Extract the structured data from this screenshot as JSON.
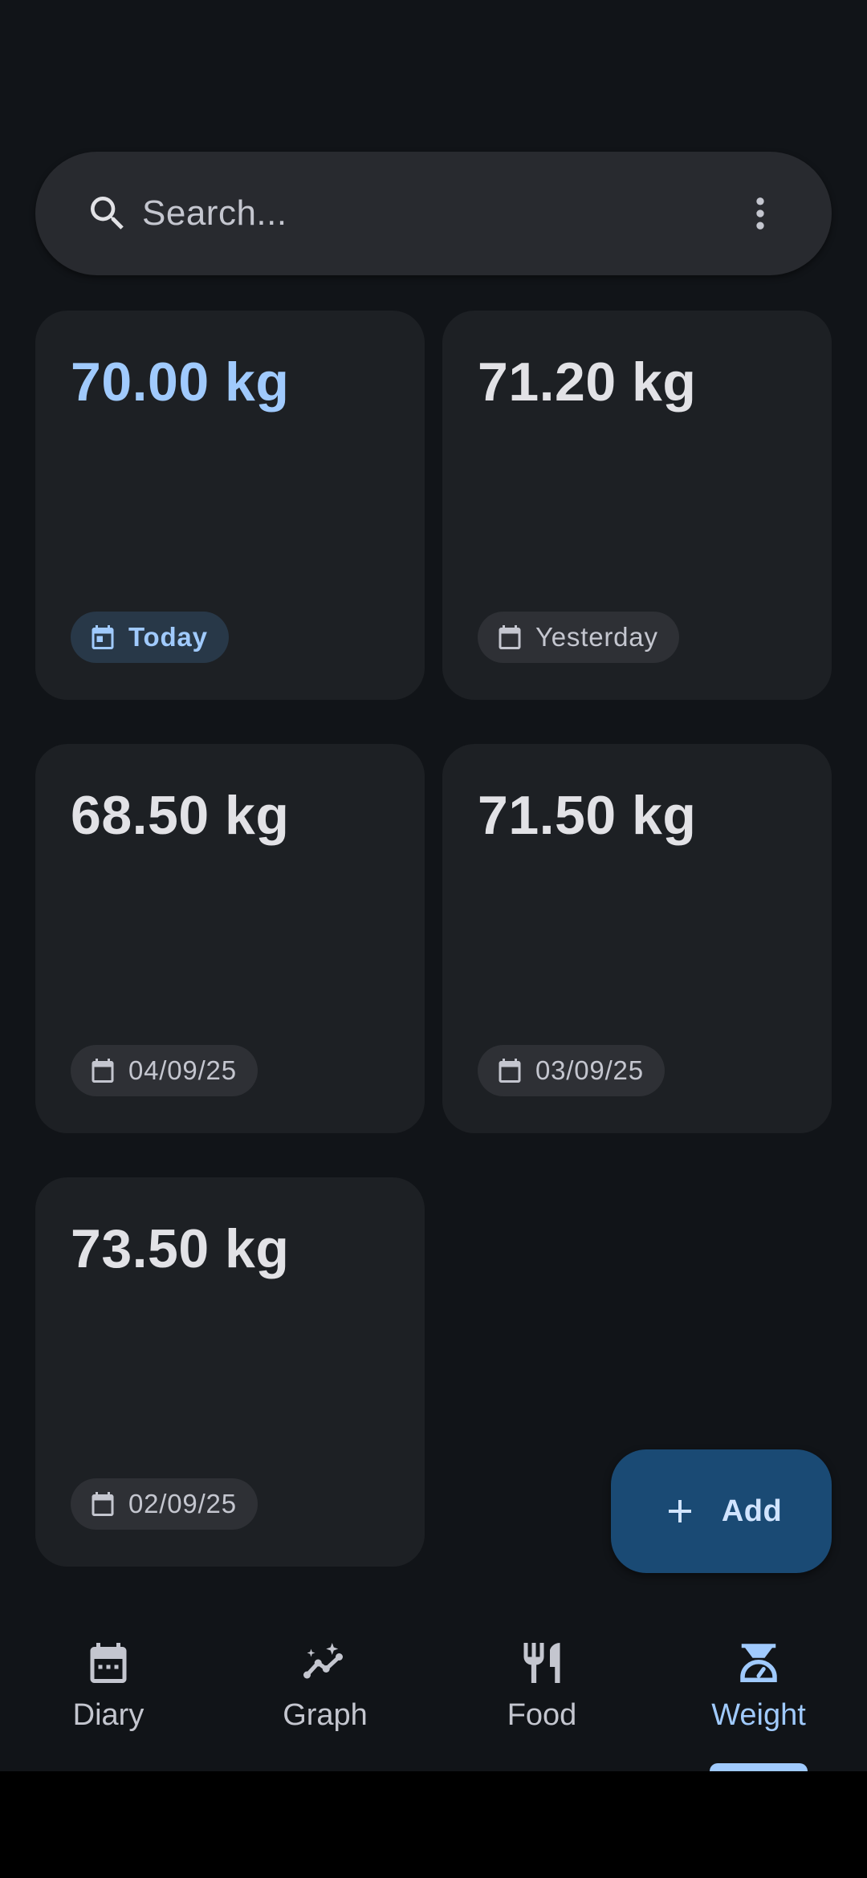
{
  "search": {
    "placeholder": "Search..."
  },
  "entries": [
    {
      "weight": "70.00 kg",
      "date": "Today",
      "highlight": true
    },
    {
      "weight": "71.20 kg",
      "date": "Yesterday",
      "highlight": false
    },
    {
      "weight": "68.50 kg",
      "date": "04/09/25",
      "highlight": false
    },
    {
      "weight": "71.50 kg",
      "date": "03/09/25",
      "highlight": false
    },
    {
      "weight": "73.50 kg",
      "date": "02/09/25",
      "highlight": false
    }
  ],
  "fab": {
    "label": "Add",
    "icon": "plus-icon"
  },
  "nav": {
    "items": [
      {
        "label": "Diary",
        "icon": "calendar-icon",
        "active": false
      },
      {
        "label": "Graph",
        "icon": "trend-sparkle-icon",
        "active": false
      },
      {
        "label": "Food",
        "icon": "fork-knife-icon",
        "active": false
      },
      {
        "label": "Weight",
        "icon": "scale-icon",
        "active": true
      }
    ]
  },
  "colors": {
    "background": "#111418",
    "surface": "#1d2024",
    "accent": "#a0cafd",
    "fab": "#1a4a74"
  }
}
